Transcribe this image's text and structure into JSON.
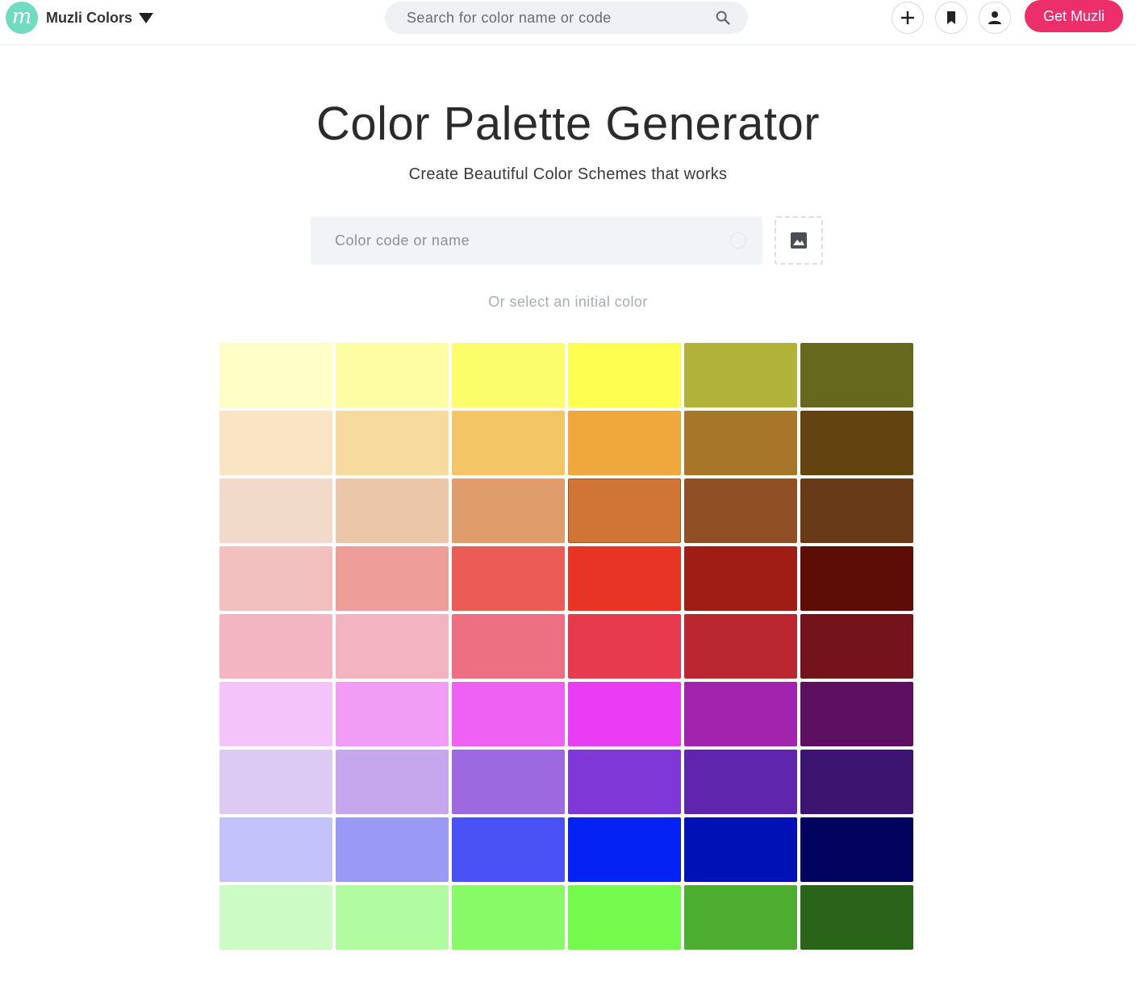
{
  "header": {
    "brand_name": "Muzli Colors",
    "logo_letter": "m",
    "search_placeholder": "Search for color name or code",
    "cta_label": "Get Muzli",
    "cta_color": "#ec2f6b",
    "logo_color": "#6fdcc0"
  },
  "hero": {
    "title": "Color Palette Generator",
    "subtitle": "Create Beautiful Color Schemes that works",
    "input_placeholder": "Color code or name",
    "hint": "Or select an initial color"
  },
  "palette": {
    "rows": [
      [
        "#fefec6",
        "#fdfda4",
        "#fcfd6b",
        "#fdfe4f",
        "#b1b23a",
        "#66691d"
      ],
      [
        "#fbe4c4",
        "#f7da9d",
        "#f4c564",
        "#f0a83c",
        "#a87628",
        "#634410"
      ],
      [
        "#f2dacb",
        "#ebc6a9",
        "#df9d6c",
        "#d17537",
        "#914f26",
        "#693a18"
      ],
      [
        "#f2c0bf",
        "#ef9d99",
        "#eb5c57",
        "#e83424",
        "#a01d16",
        "#5d0c06"
      ],
      [
        "#f2b5c1",
        "#f3b3c0",
        "#ec7082",
        "#e83a4e",
        "#bb2730",
        "#74131b"
      ],
      [
        "#f3c3f9",
        "#f19df5",
        "#ee61f3",
        "#ea3cf4",
        "#a224ad",
        "#5d1060"
      ],
      [
        "#dccaf2",
        "#c6a7ee",
        "#9d69e1",
        "#7f37d8",
        "#5f25ad",
        "#3b1570"
      ],
      [
        "#c3c2fa",
        "#9a9af6",
        "#4a52f6",
        "#0522f5",
        "#0012b6",
        "#01035e"
      ],
      [
        "#ccfbc6",
        "#b1fba0",
        "#88fa67",
        "#74fa4c",
        "#4cad30",
        "#2a6418"
      ]
    ],
    "selected": [
      2,
      3
    ]
  }
}
